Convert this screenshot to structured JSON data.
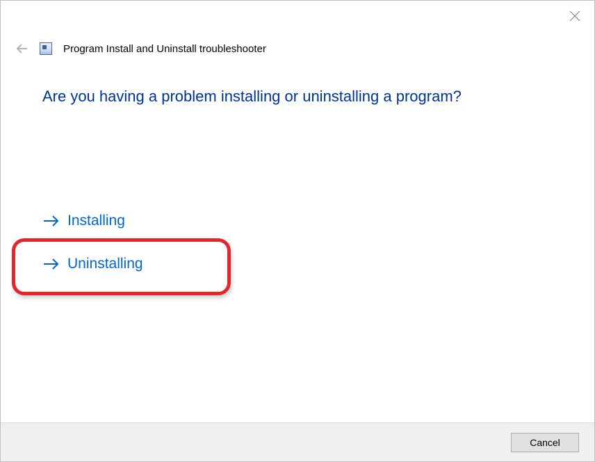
{
  "header": {
    "title": "Program Install and Uninstall troubleshooter"
  },
  "question": "Are you having a problem installing or uninstalling a program?",
  "options": {
    "install_label": "Installing",
    "uninstall_label": "Uninstalling"
  },
  "footer": {
    "cancel_label": "Cancel"
  }
}
